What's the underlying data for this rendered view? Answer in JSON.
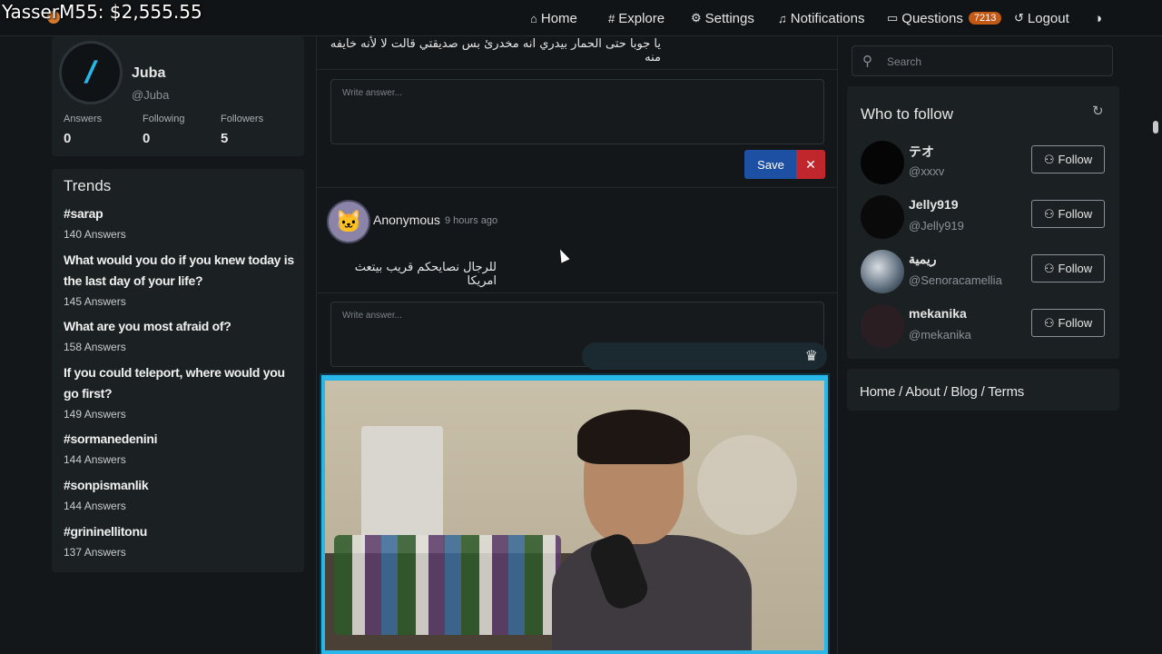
{
  "overlay": {
    "stream_title": "YasserM55: $2,555.55"
  },
  "nav": {
    "home": "Home",
    "explore": "Explore",
    "settings": "Settings",
    "notifications": "Notifications",
    "questions": "Questions",
    "questions_count": "7213",
    "logout": "Logout",
    "icons": {
      "home": "house-icon",
      "explore": "hash-icon",
      "settings": "gear-icon",
      "notifications": "bell-icon",
      "questions": "chat-icon",
      "logout": "logout-icon",
      "theme": "contrast-icon"
    }
  },
  "profile": {
    "name": "Juba",
    "handle": "@Juba",
    "stats": [
      {
        "label": "Answers",
        "value": "0"
      },
      {
        "label": "Following",
        "value": "0"
      },
      {
        "label": "Followers",
        "value": "5"
      }
    ]
  },
  "trends": {
    "title": "Trends",
    "items": [
      {
        "topic": "#sarap",
        "count": "140 Answers"
      },
      {
        "topic": "What would you do if you knew today is the last day of your life?",
        "count": "145 Answers"
      },
      {
        "topic": "What are you most afraid of?",
        "count": "158 Answers"
      },
      {
        "topic": "If you could teleport, where would you go first?",
        "count": "149 Answers"
      },
      {
        "topic": "#sormanedenini",
        "count": "144 Answers"
      },
      {
        "topic": "#sonpismanlik",
        "count": "144 Answers"
      },
      {
        "topic": "#grininellitonu",
        "count": "137 Answers"
      }
    ]
  },
  "feed": {
    "question1_text": "يا جوبا حتى الحمار بيدري انه مخدرئ بس صديقتي قالت لا لأنه خايفه منه",
    "answer_placeholder": "Write answer...",
    "save_label": "Save",
    "cancel_label": "✕",
    "question2": {
      "author": "Anonymous",
      "time": "9 hours ago",
      "text": "للرجال نصايحكم قريب بيتعث امريكا"
    }
  },
  "search": {
    "placeholder": "Search"
  },
  "who_to_follow": {
    "title": "Who to follow",
    "follow_label": "Follow",
    "users": [
      {
        "name": "テオ",
        "handle": "@xxxv"
      },
      {
        "name": "Jelly919",
        "handle": "@Jelly919"
      },
      {
        "name": "ريمية",
        "handle": "@Senoracamellia"
      },
      {
        "name": "mekanika",
        "handle": "@mekanika"
      }
    ]
  },
  "footer_links": "Home / About / Blog / Terms",
  "colors": {
    "accent": "#29b6e8",
    "badge": "#c25a15",
    "save": "#1d4fa3",
    "cancel": "#c0272d"
  }
}
